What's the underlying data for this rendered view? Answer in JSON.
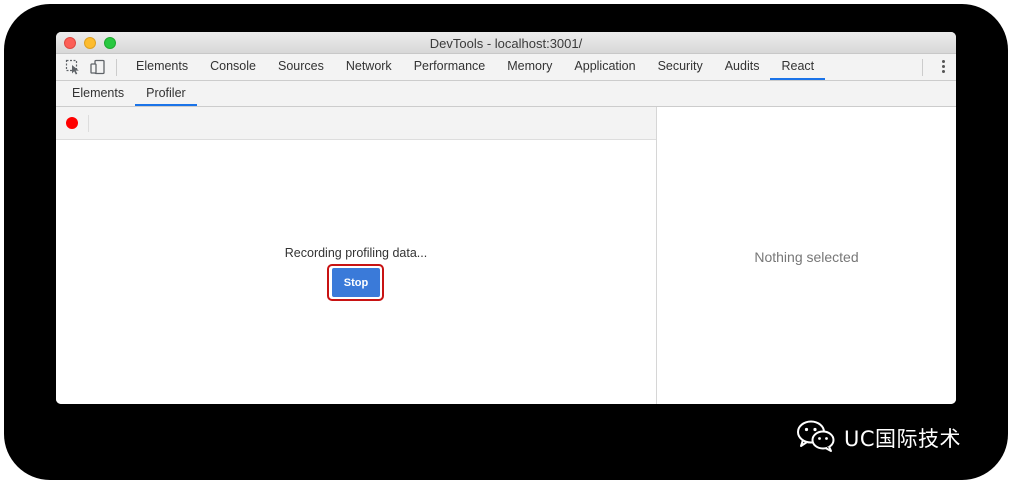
{
  "window": {
    "title": "DevTools - localhost:3001/"
  },
  "toolbar": {
    "inspect_icon": "inspect-element-icon",
    "device_icon": "device-toolbar-icon",
    "menu_icon": "kebab-menu-icon",
    "tabs": [
      {
        "label": "Elements"
      },
      {
        "label": "Console"
      },
      {
        "label": "Sources"
      },
      {
        "label": "Network"
      },
      {
        "label": "Performance"
      },
      {
        "label": "Memory"
      },
      {
        "label": "Application"
      },
      {
        "label": "Security"
      },
      {
        "label": "Audits"
      },
      {
        "label": "React",
        "active": true
      }
    ]
  },
  "subtabs": [
    {
      "label": "Elements"
    },
    {
      "label": "Profiler",
      "active": true
    }
  ],
  "profiler": {
    "record_icon": "record-icon",
    "status_text": "Recording profiling data...",
    "stop_label": "Stop"
  },
  "details": {
    "empty_text": "Nothing selected"
  },
  "watermark": {
    "text": "UC国际技术",
    "icon": "wechat-icon"
  },
  "colors": {
    "accent": "#1a73e8",
    "stop_button": "#3a7ad9",
    "record": "#ff0000",
    "highlight": "#c81313"
  }
}
